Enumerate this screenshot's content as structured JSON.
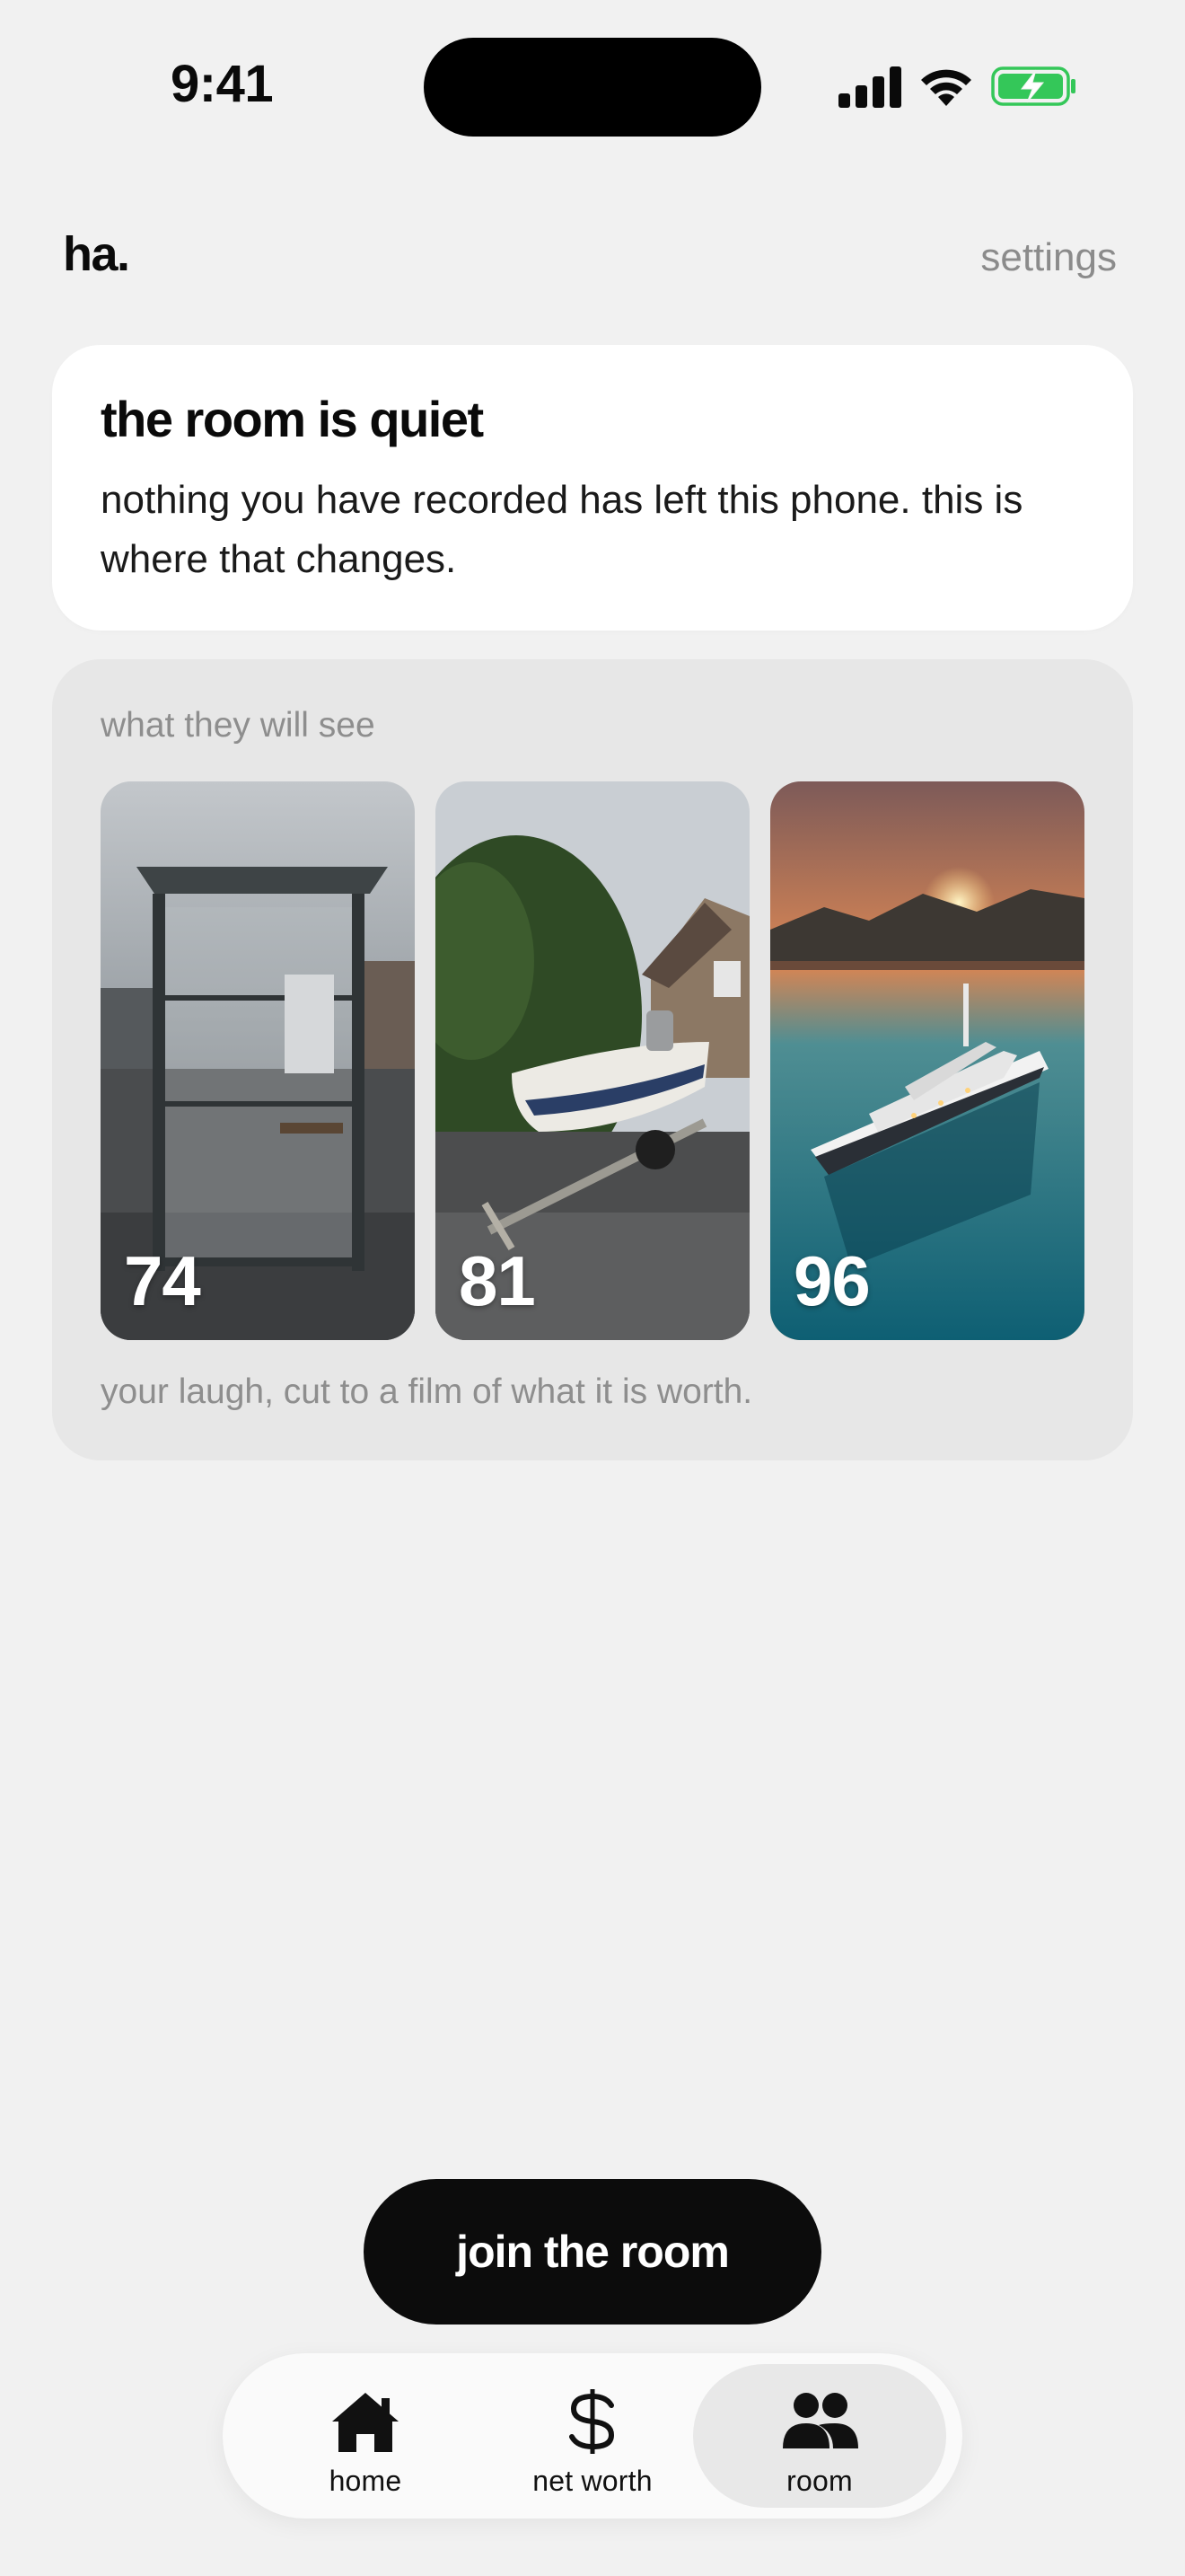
{
  "status_bar": {
    "time": "9:41"
  },
  "header": {
    "brand": "ha.",
    "settings_label": "settings"
  },
  "quiet_card": {
    "title": "the room is quiet",
    "body": "nothing you have recorded has left this phone. this is where that changes."
  },
  "preview": {
    "label": "what they will see",
    "tiles": [
      {
        "score": "74",
        "scene": "bus shelter on a rainy street"
      },
      {
        "score": "81",
        "scene": "small boat on a trailer in a driveway"
      },
      {
        "score": "96",
        "scene": "luxury yacht at sunset"
      }
    ],
    "caption": "your laugh, cut to a film of what it is worth."
  },
  "join_button": {
    "label": "join the room"
  },
  "tab_bar": {
    "items": [
      {
        "label": "home",
        "icon": "house-icon",
        "active": false
      },
      {
        "label": "net worth",
        "icon": "dollar-icon",
        "active": false
      },
      {
        "label": "room",
        "icon": "people-icon",
        "active": true
      }
    ]
  },
  "colors": {
    "background": "#f1f1f1",
    "card": "#ffffff",
    "preview_card": "#e7e7e7",
    "button": "#0c0c0c",
    "battery_green": "#34c759"
  }
}
